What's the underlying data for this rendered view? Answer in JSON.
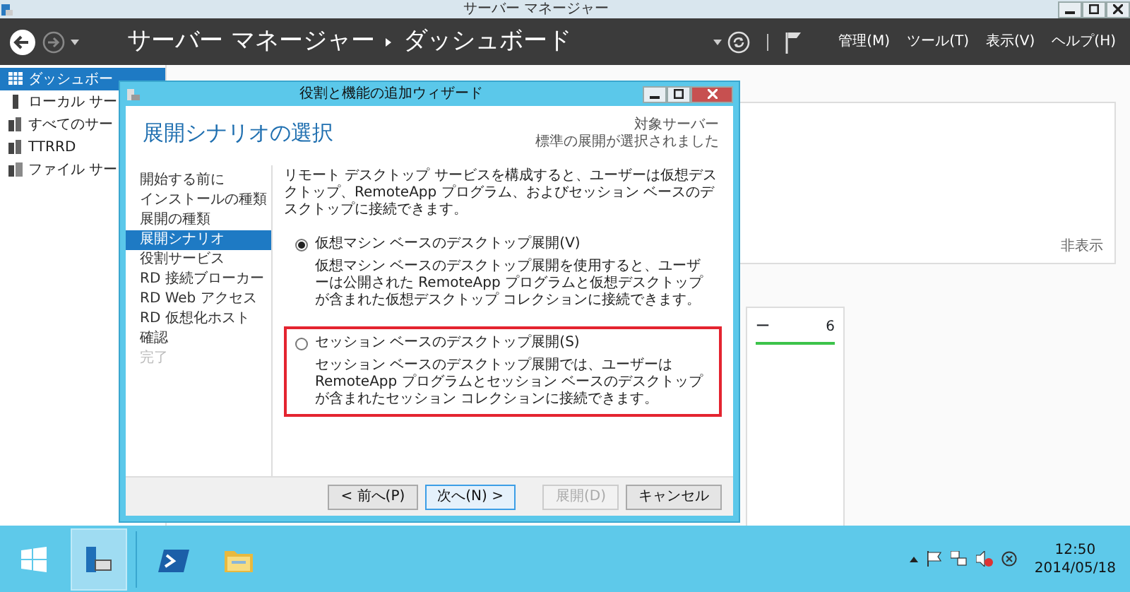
{
  "window": {
    "title": "サーバー マネージャー"
  },
  "header": {
    "breadcrumb": [
      "サーバー マネージャー",
      "ダッシュボード"
    ],
    "menus": [
      "管理(M)",
      "ツール(T)",
      "表示(V)",
      "ヘルプ(H)"
    ]
  },
  "sidebar": {
    "items": [
      {
        "label": "ダッシュボー",
        "kind": "grid",
        "selected": true
      },
      {
        "label": "ローカル サー",
        "kind": "server",
        "selected": false
      },
      {
        "label": "すべてのサー",
        "kind": "servers",
        "selected": false
      },
      {
        "label": "TTRRD",
        "kind": "servers",
        "selected": false
      },
      {
        "label": "ファイル サー",
        "kind": "files",
        "selected": false
      }
    ]
  },
  "dashboard": {
    "panel_link": "非表示",
    "tile": {
      "label": "ー",
      "count": "6"
    }
  },
  "wizard": {
    "title": "役割と機能の追加ウィザード",
    "heading": "展開シナリオの選択",
    "target_server": {
      "label": "対象サーバー",
      "value": "標準の展開が選択されました"
    },
    "steps": [
      {
        "label": "開始する前に",
        "selected": false,
        "disabled": false
      },
      {
        "label": "インストールの種類",
        "selected": false,
        "disabled": false
      },
      {
        "label": "展開の種類",
        "selected": false,
        "disabled": false
      },
      {
        "label": "展開シナリオ",
        "selected": true,
        "disabled": false
      },
      {
        "label": "役割サービス",
        "selected": false,
        "disabled": false
      },
      {
        "label": "RD 接続ブローカー",
        "selected": false,
        "disabled": false
      },
      {
        "label": "RD Web アクセス",
        "selected": false,
        "disabled": false
      },
      {
        "label": "RD 仮想化ホスト",
        "selected": false,
        "disabled": false
      },
      {
        "label": "確認",
        "selected": false,
        "disabled": false
      },
      {
        "label": "完了",
        "selected": false,
        "disabled": true
      }
    ],
    "intro": "リモート デスクトップ サービスを構成すると、ユーザーは仮想デスクトップ、RemoteApp プログラム、およびセッション ベースのデスクトップに接続できます。",
    "options": [
      {
        "label": "仮想マシン ベースのデスクトップ展開(V)",
        "description": "仮想マシン ベースのデスクトップ展開を使用すると、ユーザーは公開された RemoteApp プログラムと仮想デスクトップが含まれた仮想デスクトップ コレクションに接続できます。",
        "selected": true,
        "highlighted": false
      },
      {
        "label": "セッション ベースのデスクトップ展開(S)",
        "description": "セッション ベースのデスクトップ展開では、ユーザーは RemoteApp プログラムとセッション ベースのデスクトップが含まれたセッション コレクションに接続できます。",
        "selected": false,
        "highlighted": true
      }
    ],
    "buttons": [
      {
        "label": "< 前へ(P)",
        "disabled": false,
        "default": false
      },
      {
        "label": "次へ(N) >",
        "disabled": false,
        "default": true
      },
      {
        "label": "展開(D)",
        "disabled": true,
        "default": false
      },
      {
        "label": "キャンセル",
        "disabled": false,
        "default": false
      }
    ]
  },
  "taskbar": {
    "apps": [
      {
        "kind": "server-manager",
        "active": true
      },
      {
        "kind": "powershell",
        "active": false
      },
      {
        "kind": "explorer",
        "active": false
      }
    ],
    "clock": {
      "time": "12:50",
      "date": "2014/05/18"
    }
  }
}
